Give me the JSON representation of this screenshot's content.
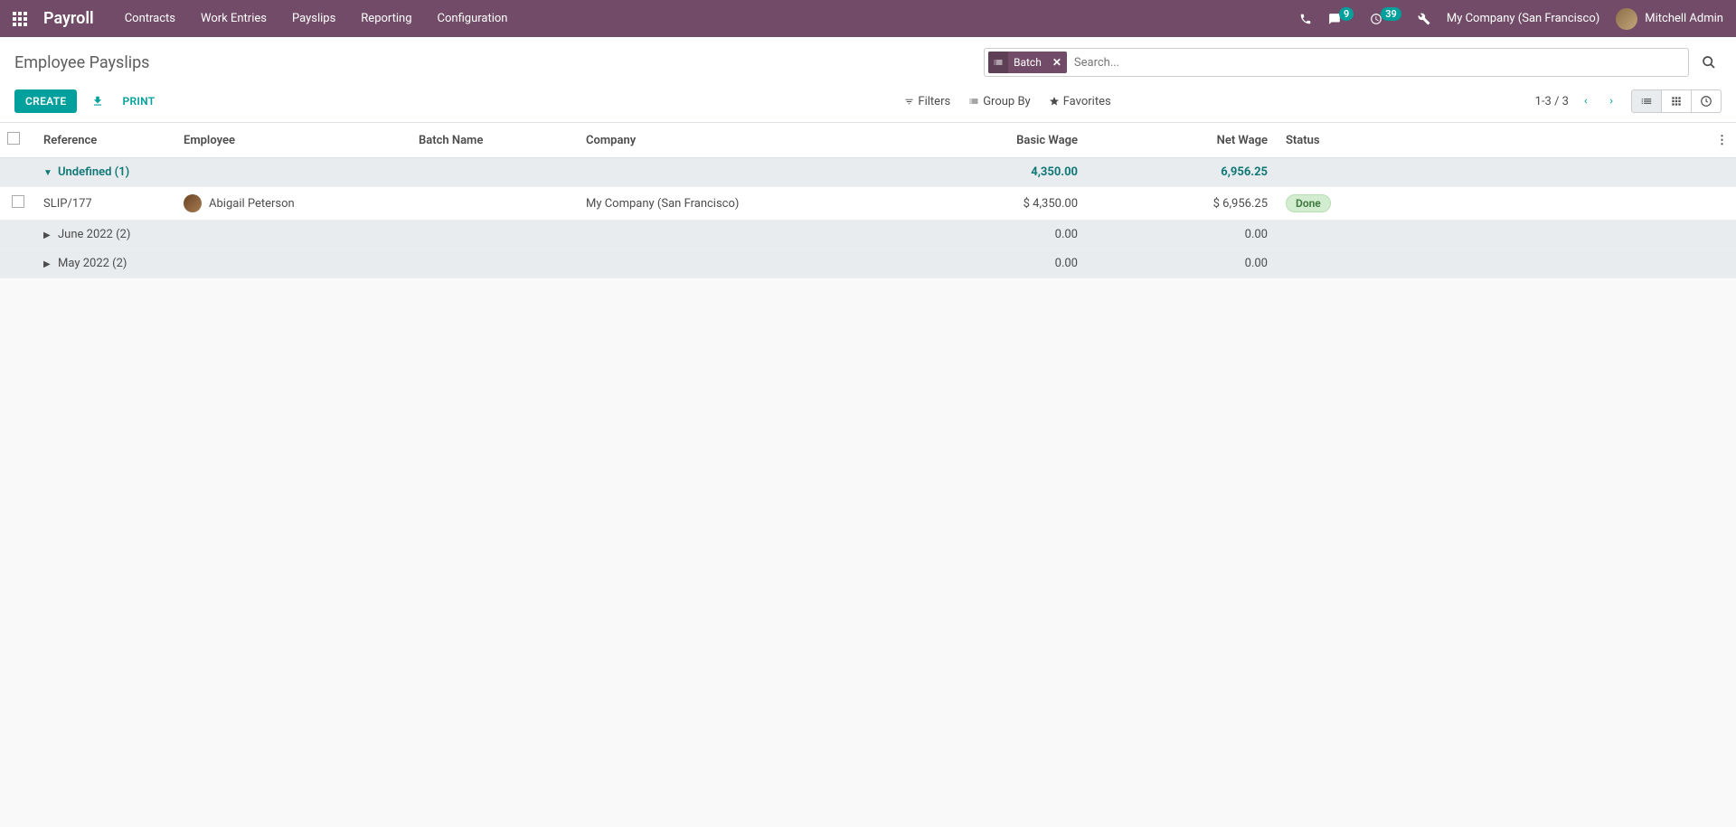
{
  "navbar": {
    "brand": "Payroll",
    "links": [
      "Contracts",
      "Work Entries",
      "Payslips",
      "Reporting",
      "Configuration"
    ],
    "messages_badge": "9",
    "activities_badge": "39",
    "company": "My Company (San Francisco)",
    "user": "Mitchell Admin"
  },
  "header": {
    "title": "Employee Payslips",
    "search_facet": "Batch",
    "search_placeholder": "Search..."
  },
  "actions": {
    "create": "CREATE",
    "print": "PRINT",
    "filters": "Filters",
    "group_by": "Group By",
    "favorites": "Favorites",
    "pager": "1-3 / 3"
  },
  "table": {
    "columns": {
      "reference": "Reference",
      "employee": "Employee",
      "batch_name": "Batch Name",
      "company": "Company",
      "basic_wage": "Basic Wage",
      "net_wage": "Net Wage",
      "status": "Status"
    },
    "groups": [
      {
        "label": "Undefined (1)",
        "expanded": true,
        "basic_wage": "4,350.00",
        "net_wage": "6,956.25",
        "rows": [
          {
            "reference": "SLIP/177",
            "employee": "Abigail Peterson",
            "batch_name": "",
            "company": "My Company (San Francisco)",
            "basic_wage": "$ 4,350.00",
            "net_wage": "$ 6,956.25",
            "status": "Done"
          }
        ]
      },
      {
        "label": "June 2022 (2)",
        "expanded": false,
        "basic_wage": "0.00",
        "net_wage": "0.00",
        "rows": []
      },
      {
        "label": "May 2022 (2)",
        "expanded": false,
        "basic_wage": "0.00",
        "net_wage": "0.00",
        "rows": []
      }
    ]
  }
}
